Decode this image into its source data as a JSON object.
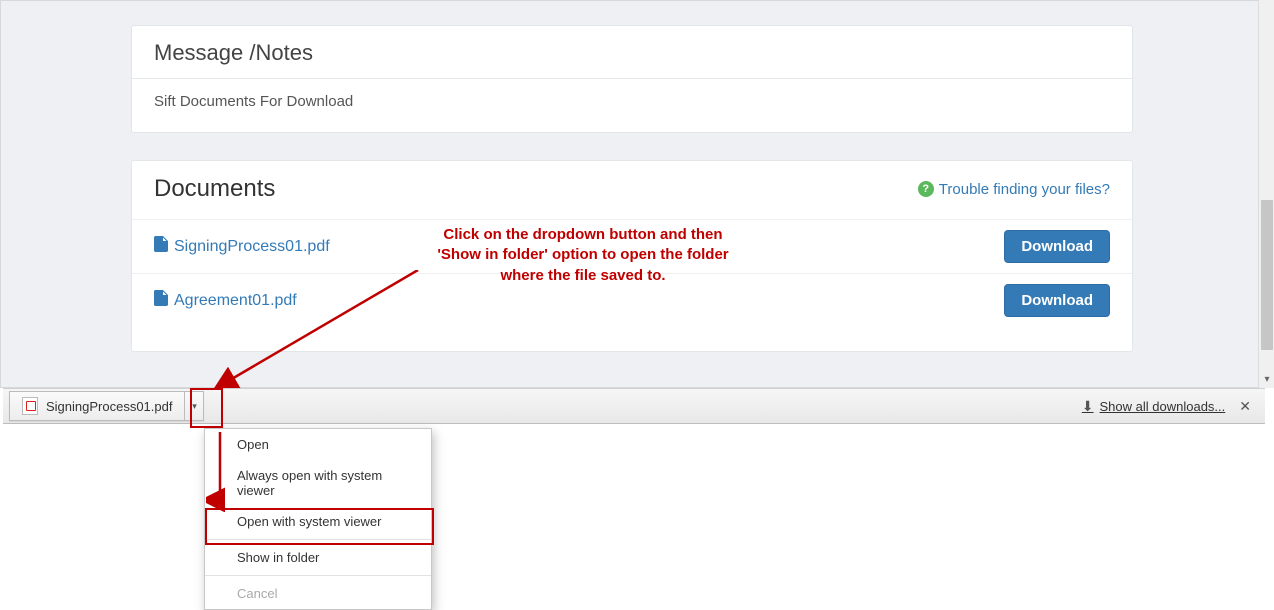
{
  "notes": {
    "title": "Message /Notes",
    "body": "Sift Documents For Download"
  },
  "documents": {
    "title": "Documents",
    "help_label": "Trouble finding your files?",
    "download_label": "Download",
    "items": [
      {
        "name": "SigningProcess01.pdf"
      },
      {
        "name": "Agreement01.pdf"
      }
    ]
  },
  "annotation": {
    "line1": "Click on the dropdown button and then",
    "line2": "'Show in folder' option to open the folder",
    "line3": "where the file saved to."
  },
  "download_bar": {
    "file": "SigningProcess01.pdf",
    "show_all": "Show all downloads..."
  },
  "context_menu": {
    "open": "Open",
    "always_open": "Always open with system viewer",
    "open_sys": "Open with system viewer",
    "show_in_folder": "Show in folder",
    "cancel": "Cancel"
  }
}
